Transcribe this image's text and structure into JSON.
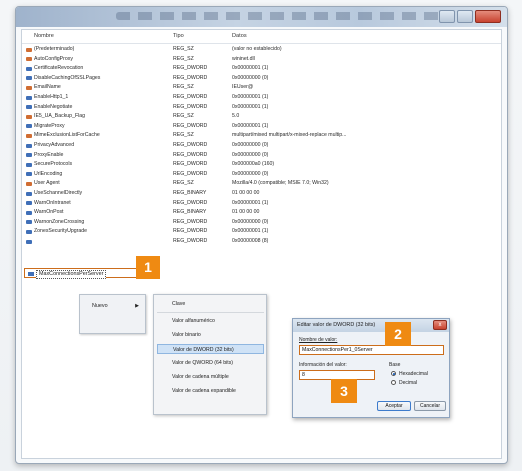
{
  "columns": {
    "name": "Nombre",
    "type": "Tipo",
    "data": "Datos"
  },
  "rows": [
    {
      "name": "(Predeterminado)",
      "type": "REG_SZ",
      "data": "(valor no establecido)",
      "icon": "string-value-icon"
    },
    {
      "name": "AutoConfigProxy",
      "type": "REG_SZ",
      "data": "wininet.dll",
      "icon": "string-value-icon"
    },
    {
      "name": "CertificateRevocation",
      "type": "REG_DWORD",
      "data": "0x00000001 (1)",
      "icon": "binary-value-icon"
    },
    {
      "name": "DisableCachingOfSSLPages",
      "type": "REG_DWORD",
      "data": "0x00000000 (0)",
      "icon": "binary-value-icon"
    },
    {
      "name": "EmailName",
      "type": "REG_SZ",
      "data": "IEUser@",
      "icon": "string-value-icon"
    },
    {
      "name": "EnableHttp1_1",
      "type": "REG_DWORD",
      "data": "0x00000001 (1)",
      "icon": "binary-value-icon"
    },
    {
      "name": "EnableNegotiate",
      "type": "REG_DWORD",
      "data": "0x00000001 (1)",
      "icon": "binary-value-icon"
    },
    {
      "name": "IE5_UA_Backup_Flag",
      "type": "REG_SZ",
      "data": "5.0",
      "icon": "string-value-icon"
    },
    {
      "name": "MigrateProxy",
      "type": "REG_DWORD",
      "data": "0x00000001 (1)",
      "icon": "binary-value-icon"
    },
    {
      "name": "MimeExclusionListForCache",
      "type": "REG_SZ",
      "data": "multipart/mixed multipart/x-mixed-replace multip...",
      "icon": "string-value-icon"
    },
    {
      "name": "PrivacyAdvanced",
      "type": "REG_DWORD",
      "data": "0x00000000 (0)",
      "icon": "binary-value-icon"
    },
    {
      "name": "ProxyEnable",
      "type": "REG_DWORD",
      "data": "0x00000000 (0)",
      "icon": "binary-value-icon"
    },
    {
      "name": "SecureProtocols",
      "type": "REG_DWORD",
      "data": "0x000000a0 (160)",
      "icon": "binary-value-icon"
    },
    {
      "name": "UrlEncoding",
      "type": "REG_DWORD",
      "data": "0x00000000 (0)",
      "icon": "binary-value-icon"
    },
    {
      "name": "User Agent",
      "type": "REG_SZ",
      "data": "Mozilla/4.0 (compatible; MSIE 7.0; Win32)",
      "icon": "string-value-icon"
    },
    {
      "name": "UseSchannelDirectly",
      "type": "REG_BINARY",
      "data": "01 00 00 00",
      "icon": "binary-value-icon"
    },
    {
      "name": "WarnOnIntranet",
      "type": "REG_DWORD",
      "data": "0x00000001 (1)",
      "icon": "binary-value-icon"
    },
    {
      "name": "WarnOnPost",
      "type": "REG_BINARY",
      "data": "01 00 00 00",
      "icon": "binary-value-icon"
    },
    {
      "name": "WarnonZoneCrossing",
      "type": "REG_DWORD",
      "data": "0x00000000 (0)",
      "icon": "binary-value-icon"
    },
    {
      "name": "ZonesSecurityUpgrade",
      "type": "REG_DWORD",
      "data": "0x00000001 (1)",
      "icon": "binary-value-icon"
    },
    {
      "name": "",
      "type": "REG_DWORD",
      "data": "0x00000008 (8)",
      "icon": "binary-value-icon"
    }
  ],
  "new_value": {
    "name": "MaxConnectionsPerServer"
  },
  "badges": {
    "one": "1",
    "two": "2",
    "three": "3"
  },
  "context_menu": {
    "new_label": "Nuevo",
    "arrow": "▶"
  },
  "submenu": {
    "items": [
      "Clave",
      "Valor alfanumérico",
      "Valor binario",
      "Valor de DWORD (32 bits)",
      "Valor de QWORD (64 bits)",
      "Valor de cadena múltiple",
      "Valor de cadena expandible"
    ],
    "highlighted_index": 3
  },
  "dialog": {
    "title": "Editar valor de DWORD (32 bits)",
    "close": "x",
    "name_label": "Nombre de valor:",
    "name_value": "MaxConnectionsPer1_0Server",
    "data_label": "Información del valor:",
    "data_value": "8",
    "base_label": "Base",
    "hex_label": "Hexadecimal",
    "dec_label": "Decimal",
    "accept": "Aceptar",
    "cancel": "Cancelar"
  },
  "colors": {
    "highlight_border": "#cc6d1b",
    "badge": "#ef8a12",
    "selection": "#cfe2f6"
  }
}
